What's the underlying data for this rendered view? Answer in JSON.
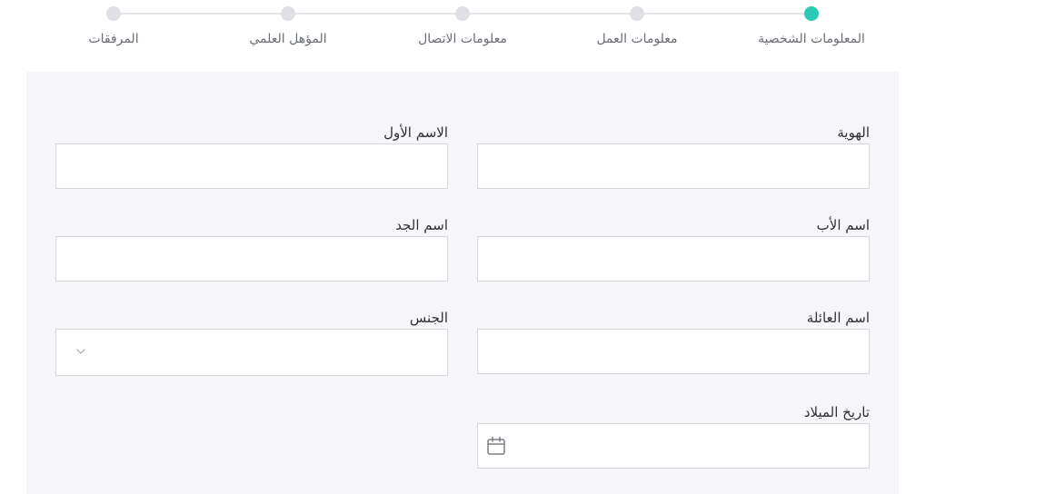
{
  "steps": [
    {
      "label": "المعلومات الشخصية",
      "active": true
    },
    {
      "label": "معلومات العمل",
      "active": false
    },
    {
      "label": "معلومات الاتصال",
      "active": false
    },
    {
      "label": "المؤهل العلمي",
      "active": false
    },
    {
      "label": "المرفقات",
      "active": false
    }
  ],
  "form": {
    "id_label": "الهوية",
    "id_value": "",
    "first_name_label": "الاسم الأول",
    "first_name_value": "",
    "father_name_label": "اسم الأب",
    "father_name_value": "",
    "grandfather_name_label": "اسم الجد",
    "grandfather_name_value": "",
    "family_name_label": "اسم العائلة",
    "family_name_value": "",
    "gender_label": "الجنس",
    "gender_value": "",
    "birth_date_label": "تاريخ الميلاد",
    "birth_date_value": ""
  },
  "colors": {
    "active_step": "#2bc8b4",
    "inactive_step": "#dfe0e5",
    "panel_bg": "#f6f6f8"
  }
}
